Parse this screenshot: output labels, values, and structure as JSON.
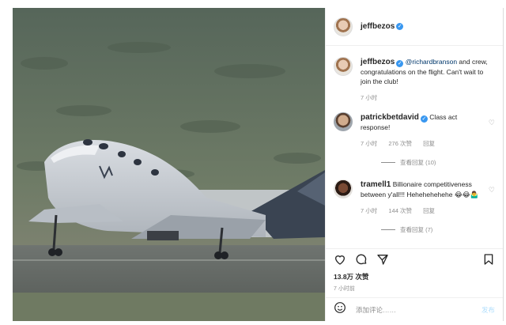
{
  "post": {
    "author": "jeffbezos",
    "caption": {
      "user": "jeffbezos",
      "mention": "@richardbranson",
      "text": " and crew, congratulations on the flight. Can't wait to join the club!",
      "time": "7 小时"
    },
    "comments": [
      {
        "user": "patrickbetdavid",
        "text": "Class act response!",
        "time": "7 小时",
        "likes": "276 次赞",
        "reply": "回复",
        "view_replies": "查看回复 (10)"
      },
      {
        "user": "tramell1",
        "text": "Billionaire competitiveness between y'all!!! Hehehehehehe 😂😂🤷‍♂️",
        "time": "7 小时",
        "likes": "144 次赞",
        "reply": "回复",
        "view_replies": "查看回复 (7)"
      }
    ],
    "like_count": "13.8万 次赞",
    "posted_ago": "7 小时前",
    "add_comment_placeholder": "添加评论……",
    "post_button": "发布"
  },
  "colors": {
    "link": "#00376b",
    "verified": "#3897f0",
    "secondary": "#8e8e8e",
    "post_disabled": "#b2dffc"
  },
  "icons": [
    "verified-icon",
    "heart-icon",
    "comment-icon",
    "share-icon",
    "bookmark-icon",
    "emoji-icon"
  ]
}
